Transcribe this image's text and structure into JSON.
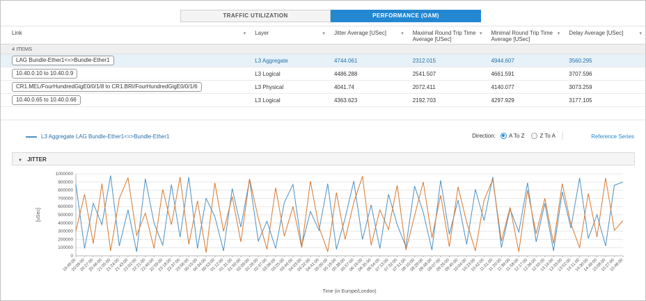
{
  "icons": {
    "caret_down": "▾",
    "triangle_down": "▼"
  },
  "colors": {
    "accent": "#2387d2",
    "selected_row_bg": "#e7f1f8",
    "series_blue": "#4a90c4",
    "series_orange": "#d9782d"
  },
  "tabs": [
    {
      "label": "TRAFFIC UTILIZATION",
      "active": false
    },
    {
      "label": "PERFORMANCE (OAM)",
      "active": true
    }
  ],
  "table": {
    "columns": [
      "Link",
      "Layer",
      "Jitter Average [USec]",
      "Maximal Round Trip Time Average [USec]",
      "Minimal Round Trip Time Average [USec]",
      "Delay Average [USec]"
    ],
    "items_label": "4 ITEMS",
    "rows": [
      {
        "link": "LAG Bundle-Ether1<=>Bundle-Ether1",
        "layer": "L3 Aggregate",
        "jitter": "4744.061",
        "max_rtt": "2312.015",
        "min_rtt": "4944.607",
        "delay": "3560.295",
        "selected": true
      },
      {
        "link": "10.40.0.10 to 10.40.0.9",
        "layer": "L3 Logical",
        "jitter": "4486.288",
        "max_rtt": "2541.507",
        "min_rtt": "4661.591",
        "delay": "3707.596",
        "selected": false
      },
      {
        "link": "CR1.MEL/FourHundredGigE0/0/1/8 to CR1.BRI/FourHundredGigE0/0/1/6",
        "layer": "L3 Physical",
        "jitter": "4041.74",
        "max_rtt": "2072.411",
        "min_rtt": "4140.077",
        "delay": "3073.259",
        "selected": false
      },
      {
        "link": "10.40.0.65 to 10.40.0.66",
        "layer": "L3 Logical",
        "jitter": "4363.623",
        "max_rtt": "2192.703",
        "min_rtt": "4297.929",
        "delay": "3177.105",
        "selected": false
      }
    ]
  },
  "legend": {
    "label": "L3 Aggregate LAG Bundle-Ether1<=>Bundle-Ether1",
    "color": "#4a90c4"
  },
  "direction": {
    "label": "Direction:",
    "options": [
      {
        "label": "A To Z",
        "selected": true
      },
      {
        "label": "Z To A",
        "selected": false
      }
    ],
    "reference_link": "Reference Series"
  },
  "jitter_panel": {
    "title": "JITTER"
  },
  "chart_data": {
    "type": "line",
    "title": "JITTER",
    "xlabel": "Time (in Europe/London)",
    "ylabel": "[uSec]",
    "ylim": [
      0,
      1000000
    ],
    "grid": "horizontal",
    "legend_position": "outside-top-left",
    "y_ticks": [
      0,
      100000,
      200000,
      300000,
      400000,
      500000,
      600000,
      700000,
      800000,
      900000,
      1000000
    ],
    "x_labels": [
      "19:49:00",
      "20:08:00",
      "20:27:00",
      "20:46:00",
      "21:05:00",
      "21:24:00",
      "21:43:00",
      "22:02:00",
      "22:21:00",
      "22:40:00",
      "22:59:00",
      "23:18:00",
      "23:37:00",
      "23:56:00",
      "00:15:00",
      "00:34:00",
      "00:53:00",
      "01:12:00",
      "01:31:00",
      "01:50:00",
      "02:09:00",
      "02:28:00",
      "02:47:00",
      "03:06:00",
      "03:25:00",
      "03:44:00",
      "04:03:00",
      "04:22:00",
      "04:41:00",
      "05:00:00",
      "05:19:00",
      "05:38:00",
      "05:57:00",
      "06:16:00",
      "06:35:00",
      "06:54:00",
      "07:13:00",
      "07:32:00",
      "07:51:00",
      "08:10:00",
      "08:29:00",
      "08:48:00",
      "09:07:00",
      "09:26:00",
      "09:45:00",
      "10:04:00",
      "10:23:00",
      "10:42:00",
      "11:01:00",
      "11:20:00",
      "11:39:00",
      "11:58:00",
      "12:17:00",
      "12:36:00",
      "12:55:00",
      "13:14:00",
      "13:33:00",
      "13:52:00",
      "14:11:00",
      "14:30:00",
      "14:49:00",
      "15:08:00",
      "15:27:00",
      "15:46:00"
    ],
    "series": [
      {
        "name": "L3 Aggregate LAG Bundle-Ether1<=>Bundle-Ether1",
        "color": "#4a90c4",
        "values": [
          870000,
          90000,
          640000,
          380000,
          980000,
          120000,
          560000,
          50000,
          940000,
          400000,
          130000,
          870000,
          230000,
          960000,
          90000,
          700000,
          480000,
          60000,
          820000,
          350000,
          930000,
          180000,
          420000,
          90000,
          650000,
          870000,
          120000,
          540000,
          310000,
          880000,
          80000,
          460000,
          910000,
          200000,
          620000,
          90000,
          750000,
          380000,
          110000,
          850000,
          530000,
          70000,
          920000,
          260000,
          680000,
          140000,
          810000,
          430000,
          960000,
          100000,
          570000,
          290000,
          890000,
          170000,
          640000,
          60000,
          780000,
          340000,
          950000,
          210000,
          500000,
          120000,
          860000,
          900000
        ]
      },
      {
        "name": "",
        "color": "#d9782d",
        "values": [
          300000,
          750000,
          150000,
          880000,
          60000,
          700000,
          950000,
          250000,
          520000,
          90000,
          810000,
          380000,
          960000,
          140000,
          670000,
          40000,
          890000,
          300000,
          720000,
          170000,
          940000,
          460000,
          80000,
          830000,
          240000,
          600000,
          100000,
          910000,
          350000,
          50000,
          770000,
          200000,
          650000,
          970000,
          130000,
          560000,
          320000,
          860000,
          70000,
          490000,
          900000,
          220000,
          740000,
          110000,
          840000,
          410000,
          60000,
          680000,
          930000,
          180000,
          590000,
          50000,
          800000,
          270000,
          700000,
          150000,
          880000,
          390000,
          100000,
          760000,
          230000,
          950000,
          310000,
          430000
        ]
      }
    ]
  }
}
